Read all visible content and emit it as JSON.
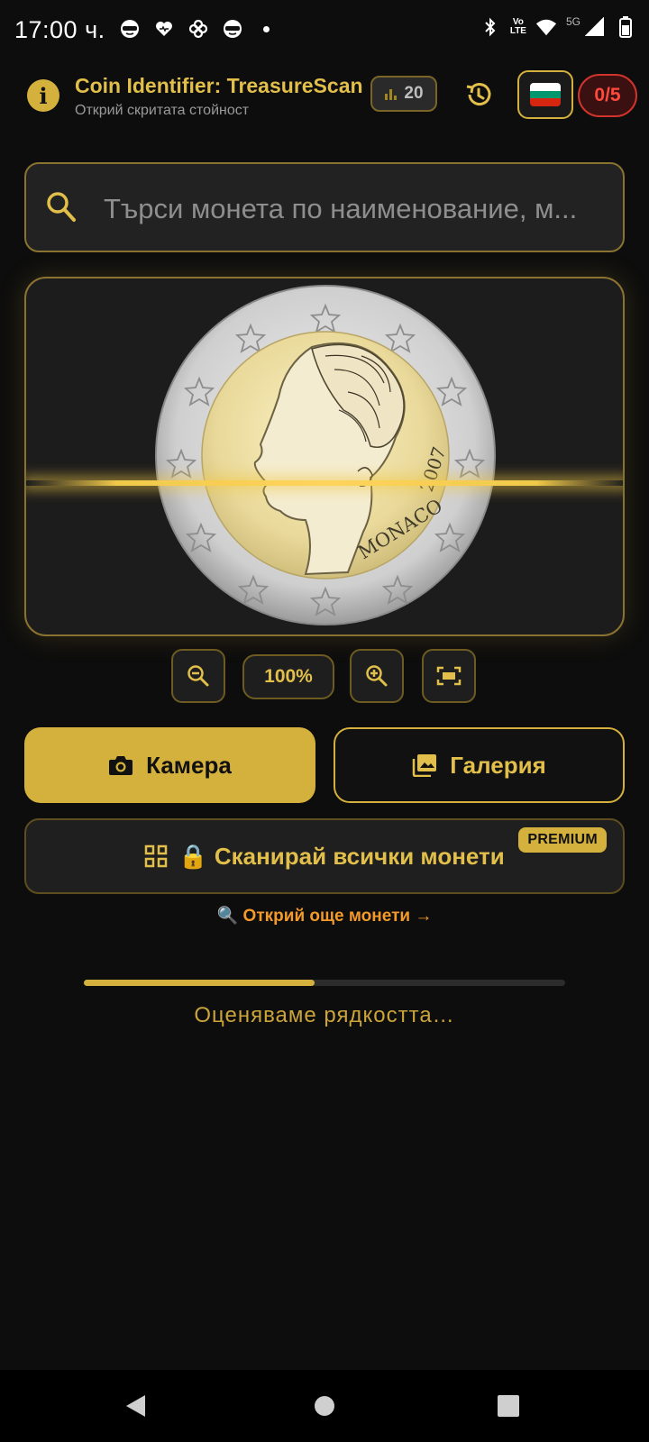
{
  "status_bar": {
    "time": "17:00 ч.",
    "network": "5G",
    "volte_top": "Vo",
    "volte_bottom": "LTE"
  },
  "header": {
    "title": "Coin Identifier: TreasureScan",
    "subtitle": "Открий скритата стойност",
    "stats_count": "20",
    "scan_quota": "0/5",
    "language_flag": "Bulgaria",
    "accent_color": "#d4b13c"
  },
  "search": {
    "placeholder": "Търси монета по наименование, м..."
  },
  "coin_preview": {
    "country": "MONACO",
    "year": "2007"
  },
  "zoom": {
    "level": "100%"
  },
  "actions": {
    "camera_label": "Камера",
    "gallery_label": "Галерия",
    "scan_all_label": "🔒 Сканирай всички монети",
    "premium_badge": "PREMIUM",
    "discover_label": "🔍 Открий още монети →"
  },
  "progress": {
    "value": 0.48,
    "text": "Оценяваме рядкостта…"
  }
}
